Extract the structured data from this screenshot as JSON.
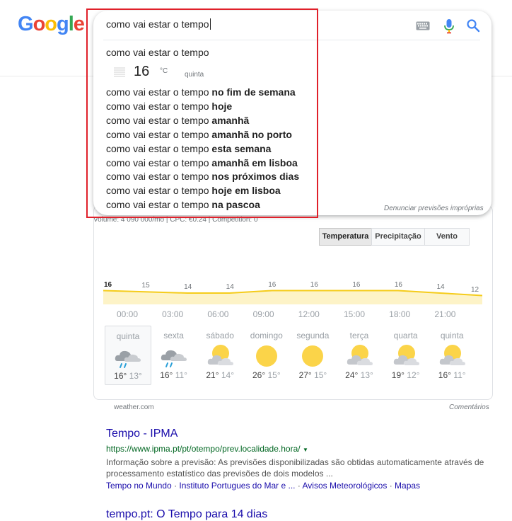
{
  "logo": {
    "text": "Google",
    "letters": [
      {
        "ch": "G",
        "color": "#4285F4"
      },
      {
        "ch": "o",
        "color": "#EA4335"
      },
      {
        "ch": "o",
        "color": "#FBBC05"
      },
      {
        "ch": "g",
        "color": "#4285F4"
      },
      {
        "ch": "l",
        "color": "#34A853"
      },
      {
        "ch": "e",
        "color": "#EA4335"
      }
    ]
  },
  "search": {
    "query": "como vai estar o tempo",
    "icons": [
      "keyboard-icon",
      "mic-icon",
      "search-icon"
    ]
  },
  "suggestions": {
    "first": "como vai estar o tempo",
    "weather": {
      "temp": "16",
      "unit": "°C",
      "day": "quinta",
      "icon": "fog-icon"
    },
    "items": [
      {
        "prefix": "como vai estar o tempo ",
        "bold": "no fim de semana"
      },
      {
        "prefix": "como vai estar o tempo ",
        "bold": "hoje"
      },
      {
        "prefix": "como vai estar o tempo ",
        "bold": "amanhã"
      },
      {
        "prefix": "como vai estar o tempo ",
        "bold": "amanhã no porto"
      },
      {
        "prefix": "como vai estar o tempo ",
        "bold": "esta semana"
      },
      {
        "prefix": "como vai estar o tempo ",
        "bold": "amanhã em lisboa"
      },
      {
        "prefix": "como vai estar o tempo ",
        "bold": "nos próximos dias"
      },
      {
        "prefix": "como vai estar o tempo ",
        "bold": "hoje em lisboa"
      },
      {
        "prefix": "como vai estar o tempo ",
        "bold": "na pascoa"
      }
    ],
    "report": "Denunciar previsões impróprias"
  },
  "weather_card": {
    "volume_line": "Volume: 4 090 000/mo | CPC: €0.24 | Competition: 0",
    "tabs": [
      "Temperatura",
      "Precipitação",
      "Vento"
    ],
    "chart_data": {
      "type": "area",
      "values": [
        16,
        15,
        14,
        14,
        16,
        16,
        16,
        16,
        14,
        12
      ],
      "ylim": [
        10,
        18
      ]
    },
    "hours": [
      "00:00",
      "03:00",
      "06:00",
      "09:00",
      "12:00",
      "15:00",
      "18:00",
      "21:00"
    ],
    "days": [
      {
        "name": "quinta",
        "hi": "16°",
        "lo": "13°",
        "icon": "cloud-rain-icon",
        "selected": true
      },
      {
        "name": "sexta",
        "hi": "16°",
        "lo": "11°",
        "icon": "cloud-rain-icon"
      },
      {
        "name": "sábado",
        "hi": "21°",
        "lo": "14°",
        "icon": "partly-cloudy-icon"
      },
      {
        "name": "domingo",
        "hi": "26°",
        "lo": "15°",
        "icon": "sun-icon"
      },
      {
        "name": "segunda",
        "hi": "27°",
        "lo": "15°",
        "icon": "sun-icon"
      },
      {
        "name": "terça",
        "hi": "24°",
        "lo": "13°",
        "icon": "partly-cloudy-icon"
      },
      {
        "name": "quarta",
        "hi": "19°",
        "lo": "12°",
        "icon": "partly-cloudy-icon"
      },
      {
        "name": "quinta",
        "hi": "16°",
        "lo": "11°",
        "icon": "partly-cloudy-icon"
      }
    ],
    "source": "weather.com",
    "comments": "Comentários"
  },
  "results": [
    {
      "title": "Tempo - IPMA",
      "url": "https://www.ipma.pt/pt/otempo/prev.localidade.hora/",
      "snippet": "Informação sobre a previsão: As previsões disponibilizadas são obtidas automaticamente através de processamento estatístico das previsões de dois modelos ...",
      "sitelinks": [
        "Tempo no Mundo",
        "Instituto Portugues do Mar e ...",
        "Avisos Meteorológicos",
        "Mapas"
      ]
    },
    {
      "title": "tempo.pt: O Tempo para 14 dias"
    }
  ],
  "colors": {
    "highlight": "#e0202a",
    "link": "#1a0dab",
    "url": "#006621",
    "chart_fill": "#fdf3c7",
    "chart_line": "#f5cc1b",
    "sun": "#fbd449"
  }
}
